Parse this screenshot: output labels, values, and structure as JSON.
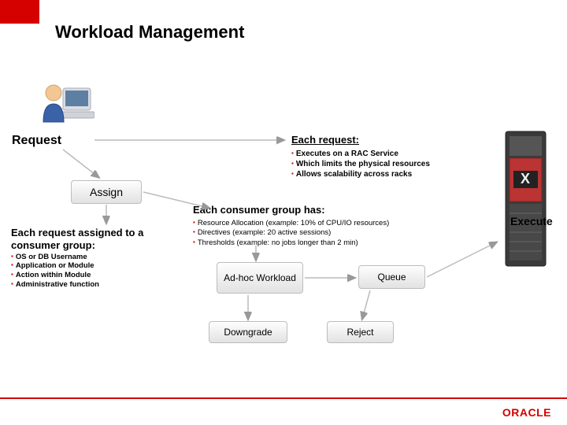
{
  "title": "Workload Management",
  "request_label": "Request",
  "each_request": {
    "heading": "Each request:",
    "bullets": [
      "Executes on a RAC Service",
      "Which limits the physical resources",
      "Allows scalability across racks"
    ]
  },
  "assign_label": "Assign",
  "consumer_group": {
    "heading": "Each consumer group has:",
    "bullets": [
      "Resource Allocation (example: 10% of CPU/IO resources)",
      "Directives (example: 20 active sessions)",
      "Thresholds (example: no jobs longer than 2 min)"
    ]
  },
  "execute_label": "Execute",
  "assigned": {
    "heading": "Each request assigned to a consumer group:",
    "bullets": [
      "OS or DB Username",
      "Application or Module",
      "Action within Module",
      "Administrative function"
    ]
  },
  "boxes": {
    "adhoc": "Ad-hoc Workload",
    "queue": "Queue",
    "downgrade": "Downgrade",
    "reject": "Reject"
  },
  "footer_brand": "ORACLE"
}
